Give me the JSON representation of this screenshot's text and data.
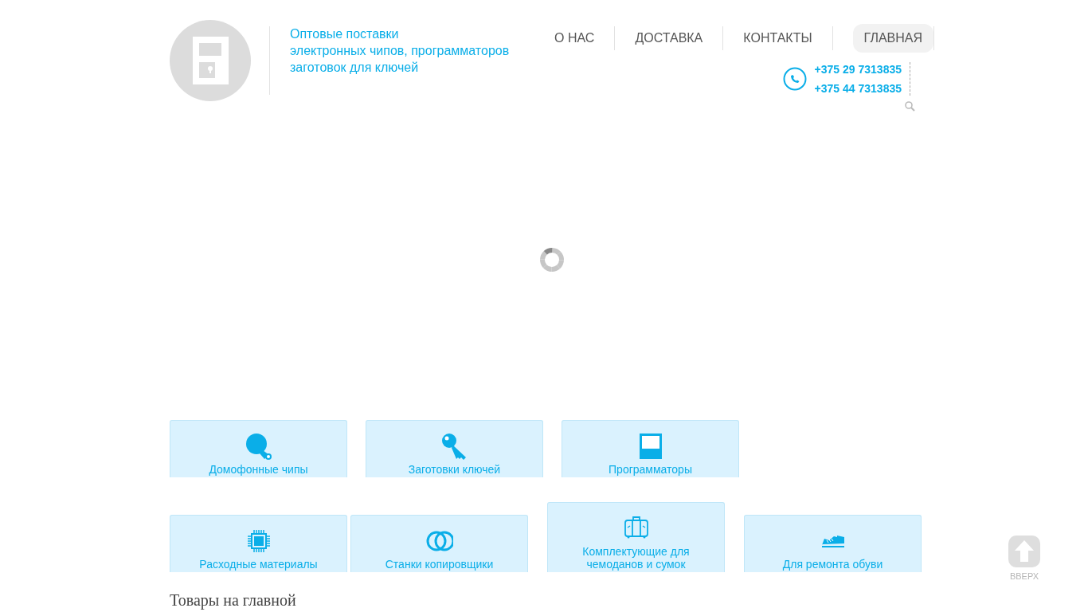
{
  "header": {
    "tagline": [
      "Оптовые поставки",
      "электронных чипов, программаторов",
      "заготовок для ключей"
    ],
    "nav": [
      {
        "label": "О НАС",
        "selected": false
      },
      {
        "label": "ДОСТАВКА",
        "selected": false
      },
      {
        "label": "КОНТАКТЫ",
        "selected": false
      },
      {
        "label": "ГЛАВНАЯ",
        "selected": true
      }
    ],
    "phones": [
      "+375 29 7313835",
      "+375 44 7313835"
    ]
  },
  "categories": [
    [
      {
        "label": "Домофонные чипы"
      },
      {
        "label": "Заготовки ключей"
      },
      {
        "label": "Программаторы"
      }
    ],
    [
      {
        "label": "Расходные материалы"
      },
      {
        "label": "Станки копировщики"
      },
      {
        "label": "Комплектующие для чемоданов и сумок"
      },
      {
        "label": "Для ремонта обуви"
      }
    ]
  ],
  "section_title": "Товары на главной",
  "to_top": {
    "label": "ВВЕРХ"
  }
}
